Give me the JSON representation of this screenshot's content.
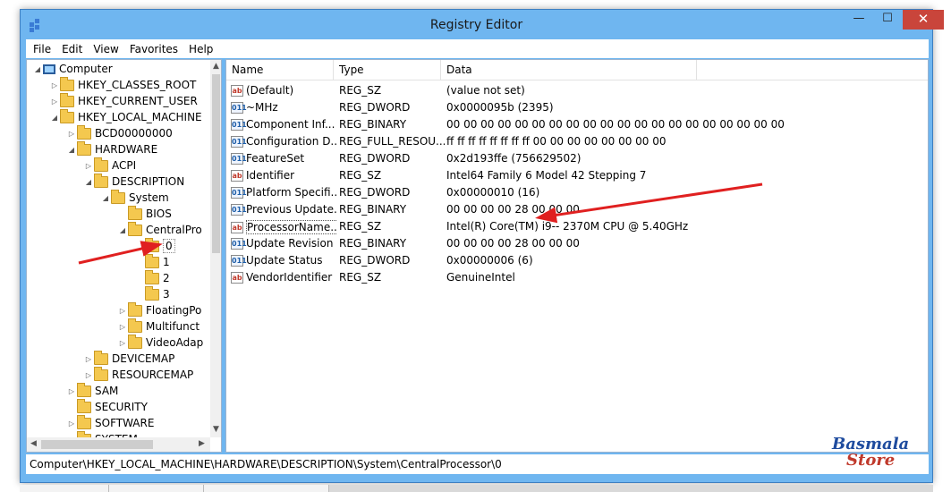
{
  "window": {
    "title": "Registry Editor",
    "minimize_glyph": "—",
    "maximize_glyph": "☐",
    "close_glyph": "✕"
  },
  "menu": [
    "File",
    "Edit",
    "View",
    "Favorites",
    "Help"
  ],
  "tree": {
    "items": [
      {
        "label": "Computer",
        "depth": 0,
        "arrow": "◢",
        "icon": "computer"
      },
      {
        "label": "HKEY_CLASSES_ROOT",
        "depth": 1,
        "arrow": "▷",
        "icon": "folder"
      },
      {
        "label": "HKEY_CURRENT_USER",
        "depth": 1,
        "arrow": "▷",
        "icon": "folder"
      },
      {
        "label": "HKEY_LOCAL_MACHINE",
        "depth": 1,
        "arrow": "◢",
        "icon": "folder"
      },
      {
        "label": "BCD00000000",
        "depth": 2,
        "arrow": "▷",
        "icon": "folder"
      },
      {
        "label": "HARDWARE",
        "depth": 2,
        "arrow": "◢",
        "icon": "folder"
      },
      {
        "label": "ACPI",
        "depth": 3,
        "arrow": "▷",
        "icon": "folder"
      },
      {
        "label": "DESCRIPTION",
        "depth": 3,
        "arrow": "◢",
        "icon": "folder"
      },
      {
        "label": "System",
        "depth": 4,
        "arrow": "◢",
        "icon": "folder"
      },
      {
        "label": "BIOS",
        "depth": 5,
        "arrow": "",
        "icon": "folder"
      },
      {
        "label": "CentralPro",
        "depth": 5,
        "arrow": "◢",
        "icon": "folder"
      },
      {
        "label": "0",
        "depth": 6,
        "arrow": "",
        "icon": "folder",
        "selected": true
      },
      {
        "label": "1",
        "depth": 6,
        "arrow": "",
        "icon": "folder"
      },
      {
        "label": "2",
        "depth": 6,
        "arrow": "",
        "icon": "folder"
      },
      {
        "label": "3",
        "depth": 6,
        "arrow": "",
        "icon": "folder"
      },
      {
        "label": "FloatingPo",
        "depth": 5,
        "arrow": "▷",
        "icon": "folder"
      },
      {
        "label": "Multifunct",
        "depth": 5,
        "arrow": "▷",
        "icon": "folder"
      },
      {
        "label": "VideoAdap",
        "depth": 5,
        "arrow": "▷",
        "icon": "folder"
      },
      {
        "label": "DEVICEMAP",
        "depth": 3,
        "arrow": "▷",
        "icon": "folder"
      },
      {
        "label": "RESOURCEMAP",
        "depth": 3,
        "arrow": "▷",
        "icon": "folder"
      },
      {
        "label": "SAM",
        "depth": 2,
        "arrow": "▷",
        "icon": "folder"
      },
      {
        "label": "SECURITY",
        "depth": 2,
        "arrow": "",
        "icon": "folder"
      },
      {
        "label": "SOFTWARE",
        "depth": 2,
        "arrow": "▷",
        "icon": "folder"
      },
      {
        "label": "SYSTEM",
        "depth": 2,
        "arrow": "▷",
        "icon": "folder"
      }
    ]
  },
  "list": {
    "columns": [
      "Name",
      "Type",
      "Data"
    ],
    "rows": [
      {
        "name": "(Default)",
        "type": "REG_SZ",
        "data": "(value not set)",
        "icon": "sz"
      },
      {
        "name": "~MHz",
        "type": "REG_DWORD",
        "data": "0x0000095b (2395)",
        "icon": "bin"
      },
      {
        "name": "Component Inf...",
        "type": "REG_BINARY",
        "data": "00 00 00 00 00 00 00 00 00 00 00 00 00 00 00 00 00 00 00 00",
        "icon": "bin"
      },
      {
        "name": "Configuration D...",
        "type": "REG_FULL_RESOU...",
        "data": "ff ff ff ff ff ff ff ff 00 00 00 00 00 00 00 00",
        "icon": "bin"
      },
      {
        "name": "FeatureSet",
        "type": "REG_DWORD",
        "data": "0x2d193ffe (756629502)",
        "icon": "bin"
      },
      {
        "name": "Identifier",
        "type": "REG_SZ",
        "data": "Intel64 Family 6 Model 42 Stepping 7",
        "icon": "sz"
      },
      {
        "name": "Platform Specifi...",
        "type": "REG_DWORD",
        "data": "0x00000010 (16)",
        "icon": "bin"
      },
      {
        "name": "Previous Update...",
        "type": "REG_BINARY",
        "data": "00 00 00 00 28 00 00 00",
        "icon": "bin"
      },
      {
        "name": "ProcessorName...",
        "type": "REG_SZ",
        "data": "Intel(R) Core(TM) i9-- 2370M CPU @ 5.40GHz",
        "icon": "sz",
        "focused": true
      },
      {
        "name": "Update Revision",
        "type": "REG_BINARY",
        "data": "00 00 00 00 28 00 00 00",
        "icon": "bin"
      },
      {
        "name": "Update Status",
        "type": "REG_DWORD",
        "data": "0x00000006 (6)",
        "icon": "bin"
      },
      {
        "name": "VendorIdentifier",
        "type": "REG_SZ",
        "data": "GenuineIntel",
        "icon": "sz"
      }
    ]
  },
  "status": {
    "path": "Computer\\HKEY_LOCAL_MACHINE\\HARDWARE\\DESCRIPTION\\System\\CentralProcessor\\0"
  },
  "icons": {
    "sz_glyph": "ab",
    "bin_glyph": "011"
  },
  "logo": {
    "top": "Basmala",
    "bottom": "Store"
  },
  "colors": {
    "window_frame": "#6fb6f0",
    "close_button": "#c9453b",
    "annotation_arrow": "#e02020",
    "folder": "#f4c84f"
  }
}
